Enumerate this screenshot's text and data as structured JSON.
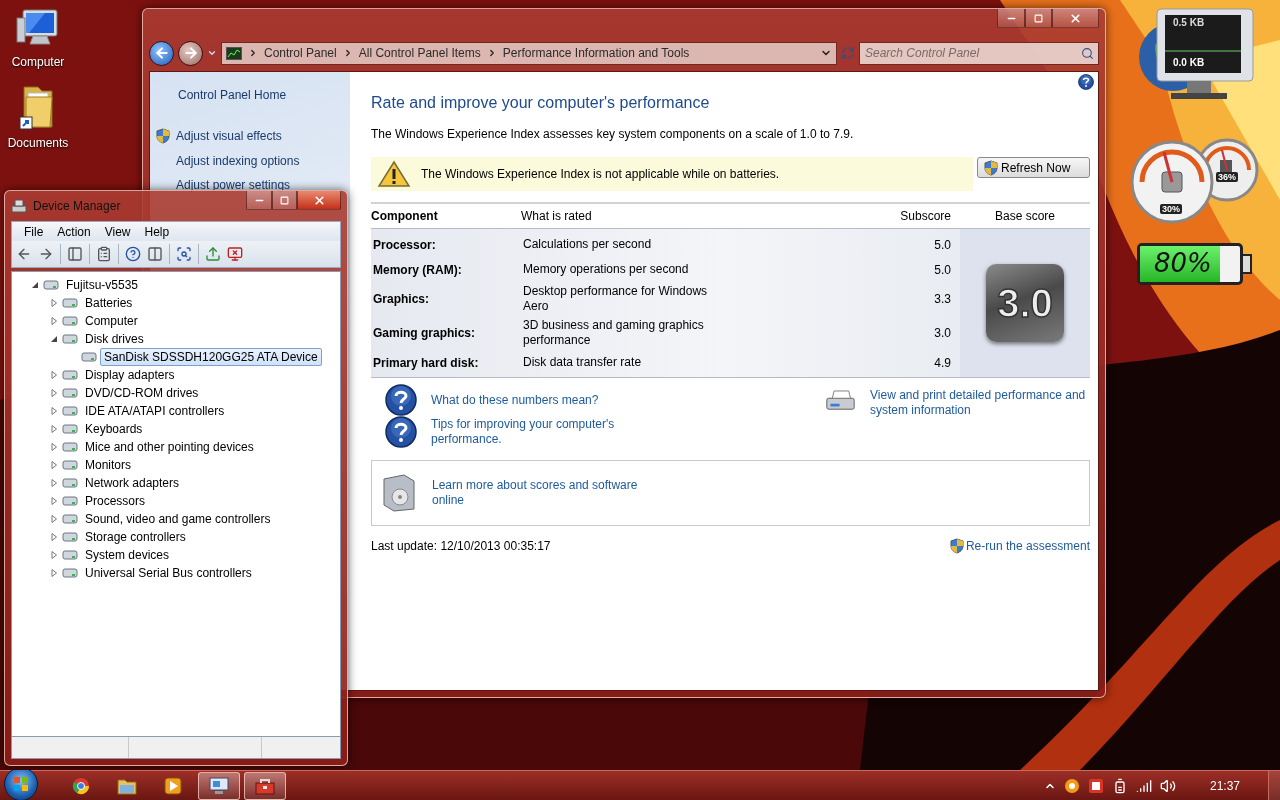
{
  "desktop_icons": [
    {
      "label": "Computer",
      "kind": "computer"
    },
    {
      "label": "Documents",
      "kind": "folder"
    }
  ],
  "control_panel": {
    "breadcrumb": [
      "Control Panel",
      "All Control Panel Items",
      "Performance Information and Tools"
    ],
    "search": {
      "placeholder": "Search Control Panel"
    },
    "sidebar": {
      "home": "Control Panel Home",
      "links": [
        {
          "label": "Adjust visual effects",
          "shield": true
        },
        {
          "label": "Adjust indexing options",
          "shield": false
        },
        {
          "label": "Adjust power settings",
          "shield": false
        }
      ]
    },
    "heading": "Rate and improve your computer's performance",
    "intro": "The Windows Experience Index assesses key system components on a scale of 1.0 to 7.9.",
    "warning": "The Windows Experience Index is not applicable while on batteries.",
    "refresh_button": "Refresh Now",
    "table": {
      "columns": [
        "Component",
        "What is rated",
        "Subscore",
        "Base score"
      ],
      "rows": [
        {
          "component": "Processor:",
          "rated": "Calculations per second",
          "subscore": "5.0"
        },
        {
          "component": "Memory (RAM):",
          "rated": "Memory operations per second",
          "subscore": "5.0"
        },
        {
          "component": "Graphics:",
          "rated": "Desktop performance for Windows Aero",
          "subscore": "3.3"
        },
        {
          "component": "Gaming graphics:",
          "rated": "3D business and gaming graphics performance",
          "subscore": "3.0"
        },
        {
          "component": "Primary hard disk:",
          "rated": "Disk data transfer rate",
          "subscore": "4.9"
        }
      ],
      "base_score": "3.0"
    },
    "help_links": [
      "What do these numbers mean?",
      "Tips for improving your computer's performance."
    ],
    "print_link": "View and print detailed performance and system information",
    "learn_more": "Learn more about scores and software online",
    "last_update": "Last update: 12/10/2013 00:35:17",
    "rerun_link": "Re-run the assessment"
  },
  "device_manager": {
    "title": "Device Manager",
    "menu": [
      "File",
      "Action",
      "View",
      "Help"
    ],
    "tree": [
      {
        "label": "Fujitsu-v5535",
        "expanded": true,
        "selected": false,
        "children": [
          {
            "label": "Batteries",
            "expanded": false,
            "selected": false
          },
          {
            "label": "Computer",
            "expanded": false,
            "selected": false
          },
          {
            "label": "Disk drives",
            "expanded": true,
            "selected": false,
            "children": [
              {
                "label": "SanDisk SDSSDH120GG25 ATA Device",
                "selected": true
              }
            ]
          },
          {
            "label": "Display adapters",
            "expanded": false,
            "selected": false
          },
          {
            "label": "DVD/CD-ROM drives",
            "expanded": false,
            "selected": false
          },
          {
            "label": "IDE ATA/ATAPI controllers",
            "expanded": false,
            "selected": false
          },
          {
            "label": "Keyboards",
            "expanded": false,
            "selected": false
          },
          {
            "label": "Mice and other pointing devices",
            "expanded": false,
            "selected": false
          },
          {
            "label": "Monitors",
            "expanded": false,
            "selected": false
          },
          {
            "label": "Network adapters",
            "expanded": false,
            "selected": false
          },
          {
            "label": "Processors",
            "expanded": false,
            "selected": false
          },
          {
            "label": "Sound, video and game controllers",
            "expanded": false,
            "selected": false
          },
          {
            "label": "Storage controllers",
            "expanded": false,
            "selected": false
          },
          {
            "label": "System devices",
            "expanded": false,
            "selected": false
          },
          {
            "label": "Universal Serial Bus controllers",
            "expanded": false,
            "selected": false
          }
        ]
      }
    ]
  },
  "gadgets": {
    "network": {
      "upload": "0.5 KB",
      "download": "0.0 KB"
    },
    "cpu_meter": {
      "cpu": "30%",
      "memory": "36%"
    },
    "battery": {
      "reading": "80%",
      "level": 0.8
    }
  },
  "taskbar": {
    "apps": [
      {
        "kind": "browser",
        "open": false
      },
      {
        "kind": "folder",
        "open": false
      },
      {
        "kind": "media",
        "open": false
      },
      {
        "kind": "control-panel",
        "open": true
      },
      {
        "kind": "device-manager",
        "open": true
      }
    ],
    "clock": "21:37"
  }
}
